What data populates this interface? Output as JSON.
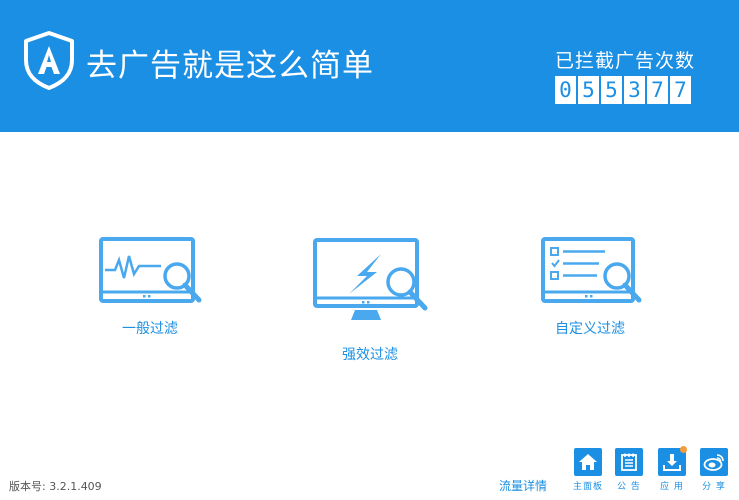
{
  "header": {
    "slogan": "去广告就是这么简单",
    "counter_label": "已拦截广告次数",
    "counter_digits": [
      "0",
      "5",
      "5",
      "3",
      "7",
      "7"
    ]
  },
  "modes": [
    {
      "label": "一般过滤",
      "icon": "monitor-pulse-search-icon"
    },
    {
      "label": "强效过滤",
      "icon": "monitor-lightning-search-icon"
    },
    {
      "label": "自定义过滤",
      "icon": "monitor-checklist-search-icon"
    }
  ],
  "footer": {
    "version": "版本号: 3.2.1.409",
    "traffic_link": "流量详情",
    "tools": [
      {
        "label": "主面板",
        "icon": "home-icon"
      },
      {
        "label": "公 告",
        "icon": "notice-icon"
      },
      {
        "label": "应 用",
        "icon": "download-icon"
      },
      {
        "label": "分 享",
        "icon": "weibo-icon"
      }
    ]
  },
  "colors": {
    "brand": "#1a8fe3",
    "notify": "#f39c3c"
  }
}
